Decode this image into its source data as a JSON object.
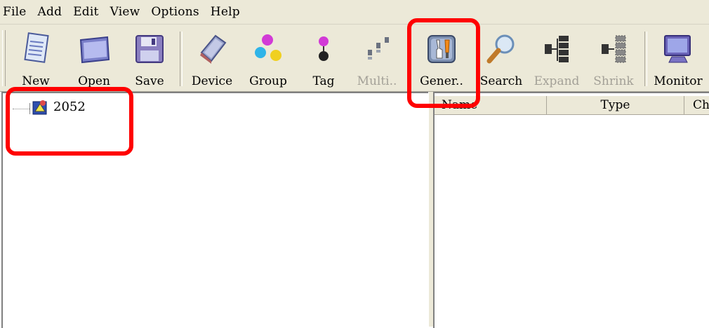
{
  "menu": [
    {
      "label": "File"
    },
    {
      "label": "Add"
    },
    {
      "label": "Edit"
    },
    {
      "label": "View"
    },
    {
      "label": "Options"
    },
    {
      "label": "Help"
    }
  ],
  "toolbar": {
    "new": "New",
    "open": "Open",
    "save": "Save",
    "device": "Device",
    "group": "Group",
    "tag": "Tag",
    "multi": "Multi..",
    "generate": "Gener..",
    "search": "Search",
    "expand": "Expand",
    "shrink": "Shrink",
    "monitor": "Monitor"
  },
  "tree": {
    "root_label": "2052"
  },
  "list": {
    "columns": [
      "Name",
      "Type",
      "Ch"
    ]
  },
  "colors": {
    "highlight": "#ff0000",
    "chrome": "#ece9d8"
  }
}
